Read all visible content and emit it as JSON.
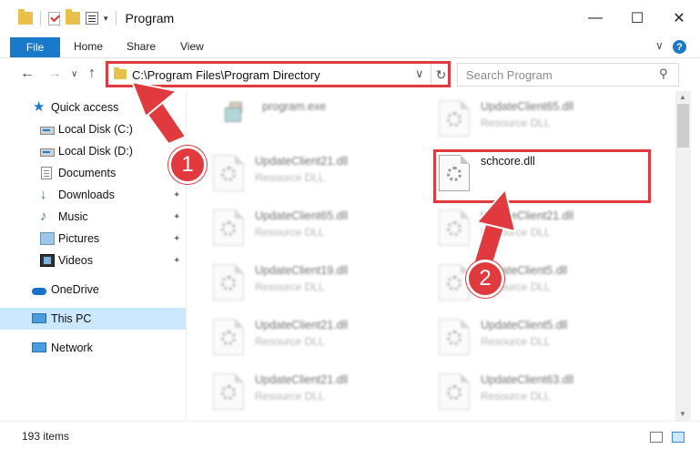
{
  "window": {
    "title": "Program",
    "minimize": "—",
    "maximize": "☐",
    "close": "✕"
  },
  "ribbon": {
    "file": "File",
    "home": "Home",
    "share": "Share",
    "view": "View",
    "help": "?",
    "expand": "∨"
  },
  "nav": {
    "back": "←",
    "forward": "→",
    "recent": "∨",
    "up": "↑",
    "address": "C:\\Program Files\\Program Directory",
    "address_dropdown": "∨",
    "refresh": "↻",
    "search_placeholder": "Search Program",
    "search_glyph": "⚲"
  },
  "sidebar": {
    "items": [
      {
        "label": "Quick access",
        "icon": "star-icon"
      },
      {
        "label": "Local Disk (C:)",
        "icon": "drive-icon",
        "pinned": true
      },
      {
        "label": "Local Disk (D:)",
        "icon": "drive-icon"
      },
      {
        "label": "Documents",
        "icon": "documents-icon",
        "pinned": true
      },
      {
        "label": "Downloads",
        "icon": "download-icon",
        "pinned": true
      },
      {
        "label": "Music",
        "icon": "music-icon",
        "pinned": true
      },
      {
        "label": "Pictures",
        "icon": "pictures-icon",
        "pinned": true
      },
      {
        "label": "Videos",
        "icon": "videos-icon",
        "pinned": true
      },
      {
        "label": "OneDrive",
        "icon": "cloud-icon"
      },
      {
        "label": "This PC",
        "icon": "computer-icon",
        "selected": true
      },
      {
        "label": "Network",
        "icon": "network-icon"
      }
    ],
    "pin_glyph": "📌"
  },
  "files": [
    {
      "name": "program.exe",
      "type": ""
    },
    {
      "name": "UpdateClient65.dll",
      "type": "Resource DLL"
    },
    {
      "name": "UpdateClient21.dll",
      "type": "Resource DLL"
    },
    {
      "name": "schcore.dll",
      "type": ""
    },
    {
      "name": "UpdateClient65.dll",
      "type": "Resource DLL"
    },
    {
      "name": "UpdateClient21.dll",
      "type": "Resource DLL"
    },
    {
      "name": "UpdateClient19.dll",
      "type": "Resource DLL"
    },
    {
      "name": "UpdateClient5.dll",
      "type": "Resource DLL"
    },
    {
      "name": "UpdateClient21.dll",
      "type": "Resource DLL"
    },
    {
      "name": "UpdateClient5.dll",
      "type": "Resource DLL"
    },
    {
      "name": "UpdateClient21.dll",
      "type": "Resource DLL"
    },
    {
      "name": "UpdateClient63.dll",
      "type": "Resource DLL"
    }
  ],
  "annotations": {
    "step1": "1",
    "step2": "2",
    "color": "#e0393e"
  },
  "status": {
    "item_count": "193 items"
  },
  "colors": {
    "accent": "#1979ca",
    "selection": "#cce8ff"
  }
}
